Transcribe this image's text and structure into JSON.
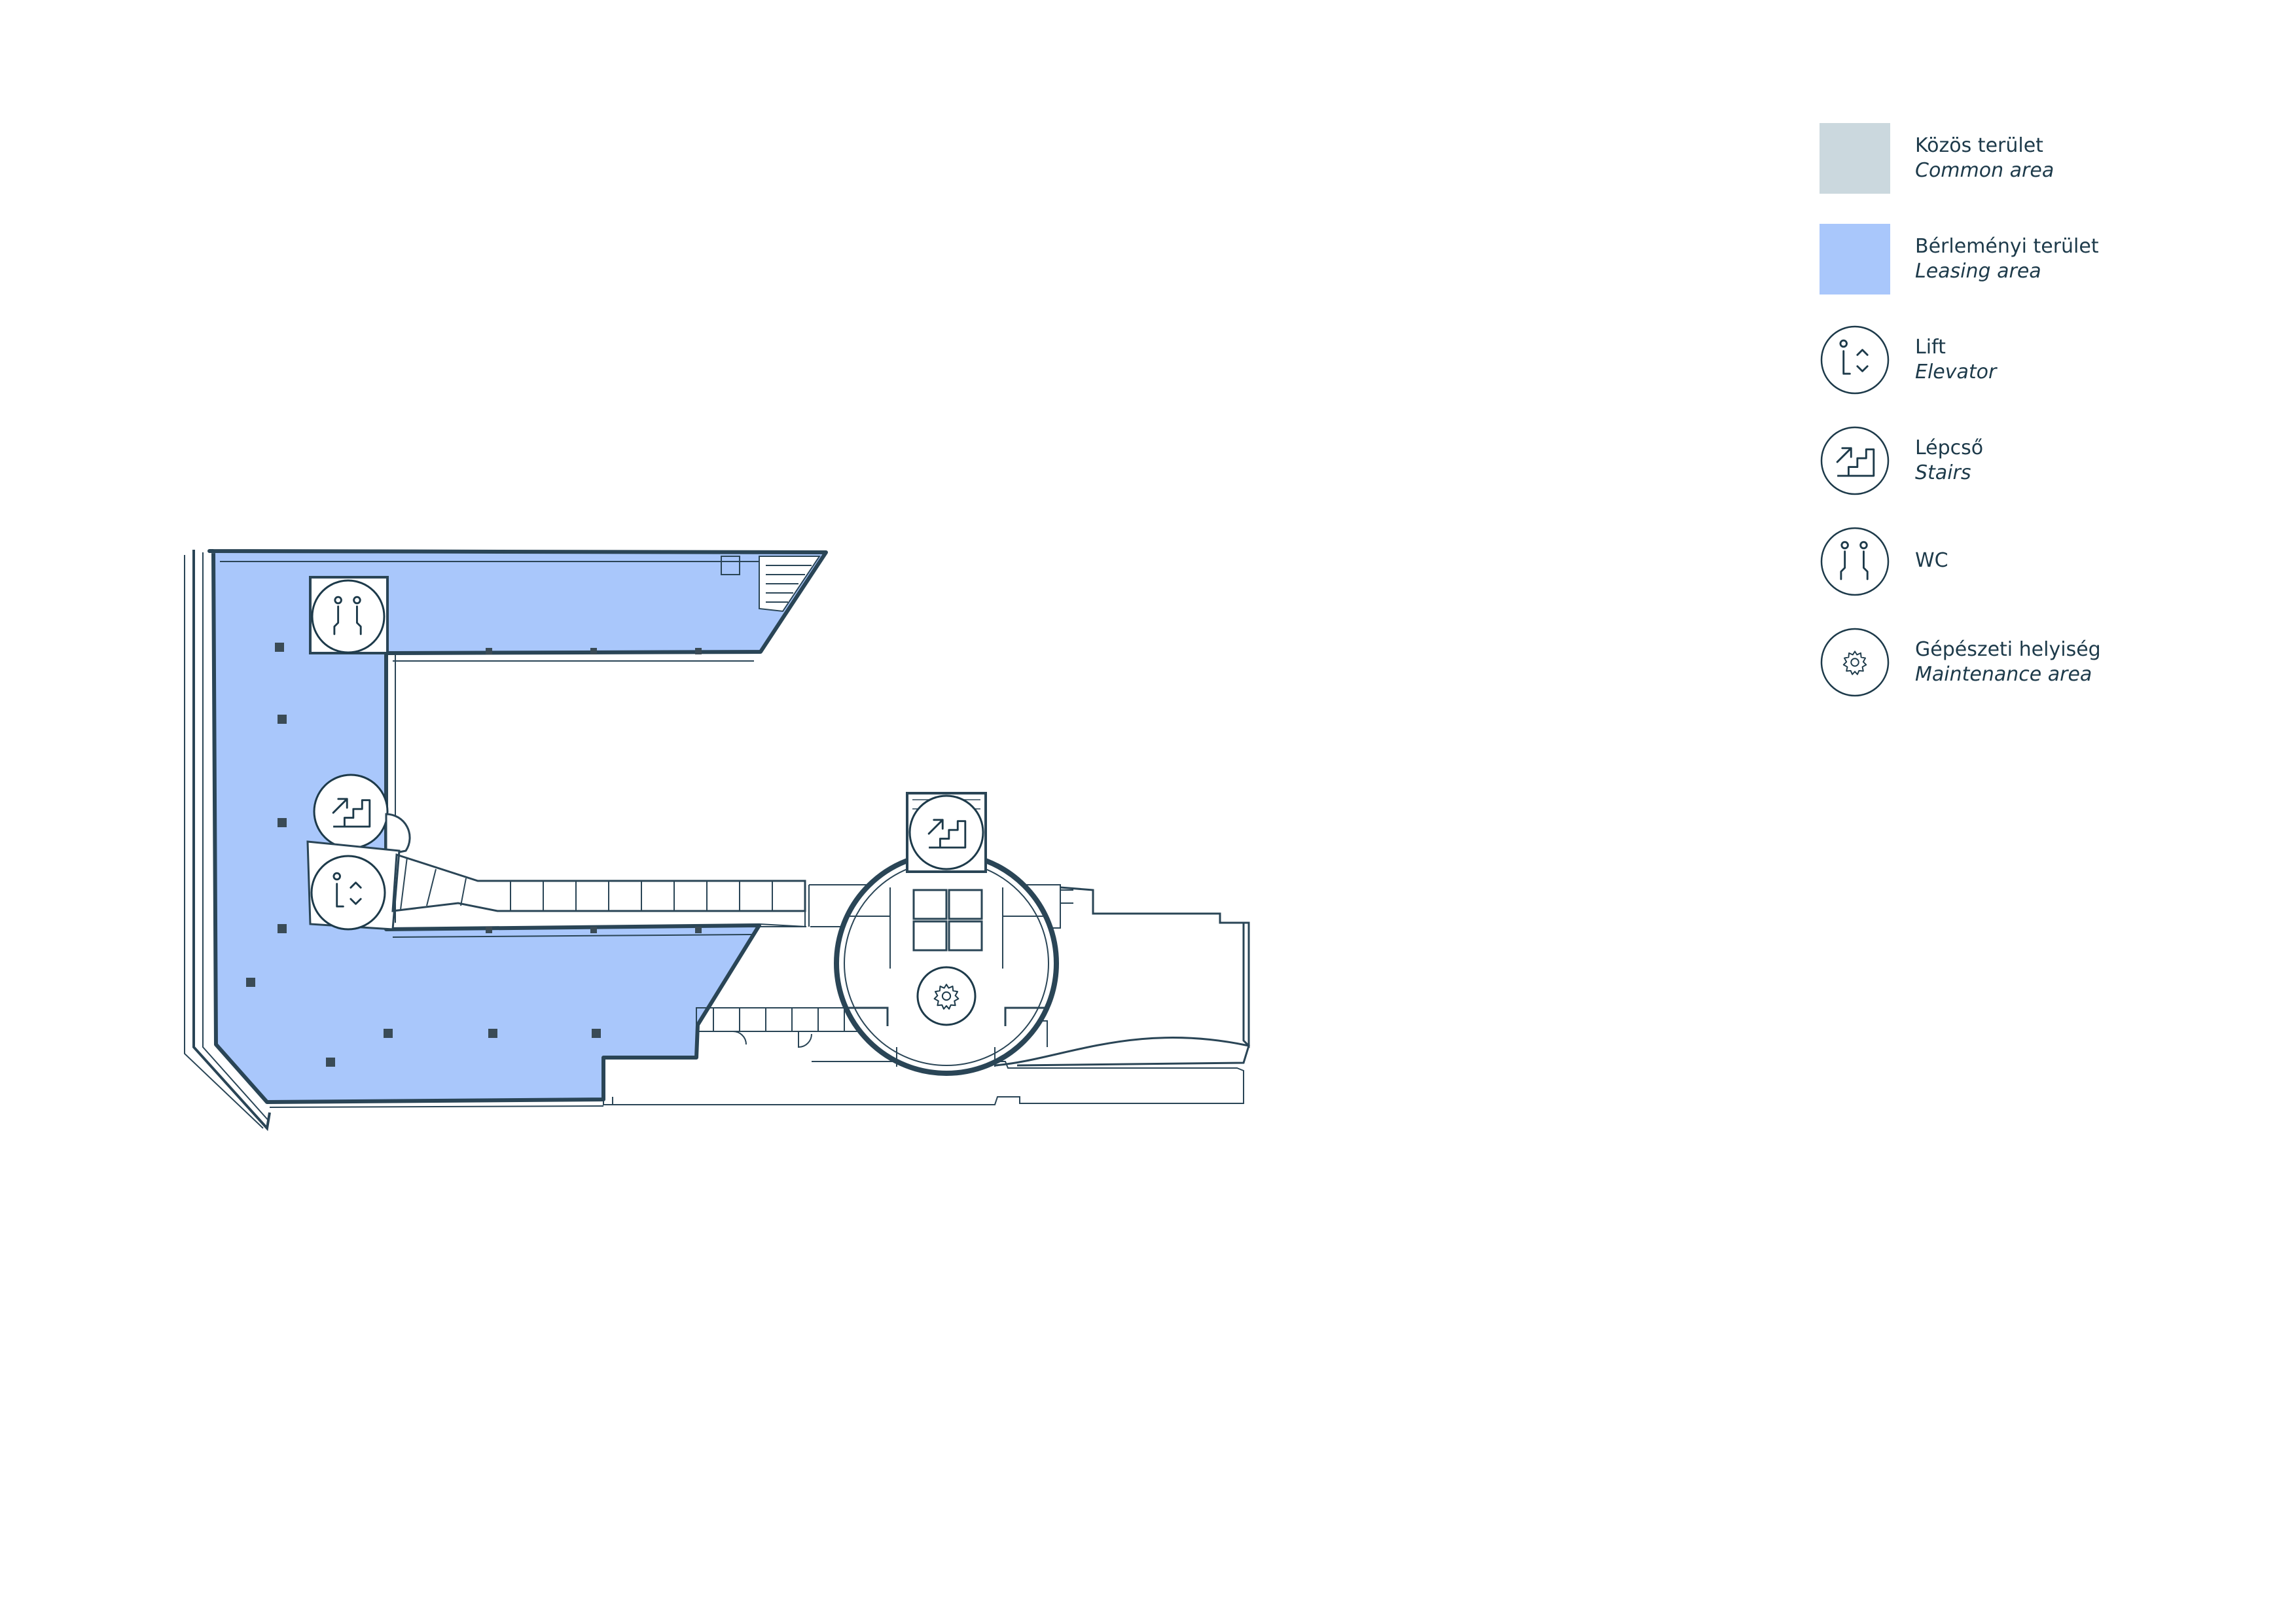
{
  "colors": {
    "common_area": "#cbd8de",
    "leasing_area": "#a9c7fb",
    "line": "#1d3a4a",
    "wall": "#2a4556",
    "background": "#ffffff"
  },
  "legend": {
    "items": [
      {
        "kind": "swatch",
        "swatch_color": "#cbd8de",
        "label_hu": "Közös terület",
        "label_en": "Common area"
      },
      {
        "kind": "swatch",
        "swatch_color": "#a9c7fb",
        "label_hu": "Bérleményi terület",
        "label_en": "Leasing area"
      },
      {
        "kind": "icon",
        "icon": "elevator-icon",
        "label_hu": "Lift",
        "label_en": "Elevator"
      },
      {
        "kind": "icon",
        "icon": "stairs-icon",
        "label_hu": "Lépcső",
        "label_en": "Stairs"
      },
      {
        "kind": "icon",
        "icon": "wc-icon",
        "label_hu": "WC",
        "label_en": ""
      },
      {
        "kind": "icon",
        "icon": "gear-icon",
        "label_hu": "Gépészeti helyiség",
        "label_en": "Maintenance area"
      }
    ]
  },
  "plan": {
    "markers": [
      "wc-icon",
      "stairs-icon",
      "elevator-icon",
      "stairs-icon",
      "gear-icon"
    ]
  }
}
